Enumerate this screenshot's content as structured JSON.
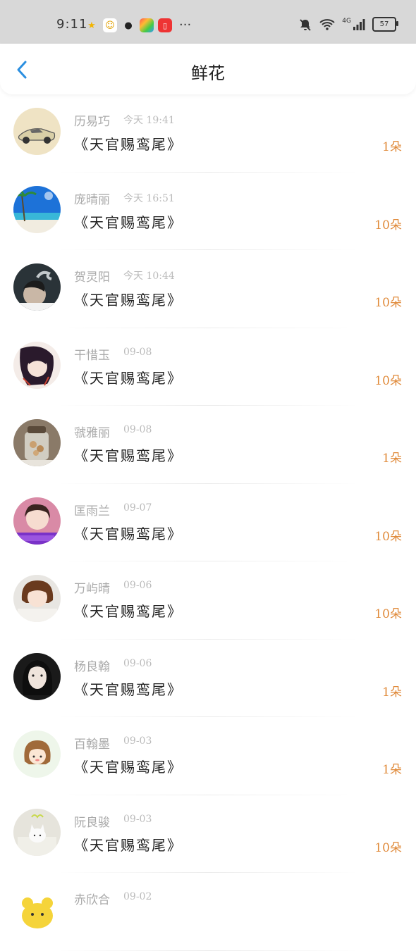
{
  "status_bar": {
    "time": "9:11",
    "battery": "57",
    "network": "4G"
  },
  "header": {
    "title": "鲜花",
    "accent_color": "#2b8fe0"
  },
  "list": [
    {
      "name": "历易巧",
      "time": "今天 19:41",
      "book": "《天官赐鸾尾》",
      "count": "1朵",
      "avatar": "car"
    },
    {
      "name": "庞晴丽",
      "time": "今天 16:51",
      "book": "《天官赐鸾尾》",
      "count": "10朵",
      "avatar": "beach"
    },
    {
      "name": "贺灵阳",
      "time": "今天 10:44",
      "book": "《天官赐鸾尾》",
      "count": "10朵",
      "avatar": "smoke"
    },
    {
      "name": "干惜玉",
      "time": "09-08",
      "book": "《天官赐鸾尾》",
      "count": "10朵",
      "avatar": "anime"
    },
    {
      "name": "虢雅丽",
      "time": "09-08",
      "book": "《天官赐鸾尾》",
      "count": "1朵",
      "avatar": "jar"
    },
    {
      "name": "匡雨兰",
      "time": "09-07",
      "book": "《天官赐鸾尾》",
      "count": "10朵",
      "avatar": "girl-purple"
    },
    {
      "name": "万屿晴",
      "time": "09-06",
      "book": "《天官赐鸾尾》",
      "count": "10朵",
      "avatar": "girl-bob"
    },
    {
      "name": "杨良翰",
      "time": "09-06",
      "book": "《天官赐鸾尾》",
      "count": "1朵",
      "avatar": "girl-dark"
    },
    {
      "name": "百翰墨",
      "time": "09-03",
      "book": "《天官赐鸾尾》",
      "count": "1朵",
      "avatar": "cartoon"
    },
    {
      "name": "阮良骏",
      "time": "09-03",
      "book": "《天官赐鸾尾》",
      "count": "10朵",
      "avatar": "cat"
    },
    {
      "name": "赤欣合",
      "time": "09-02",
      "book": "",
      "count": "",
      "avatar": "bear"
    }
  ]
}
